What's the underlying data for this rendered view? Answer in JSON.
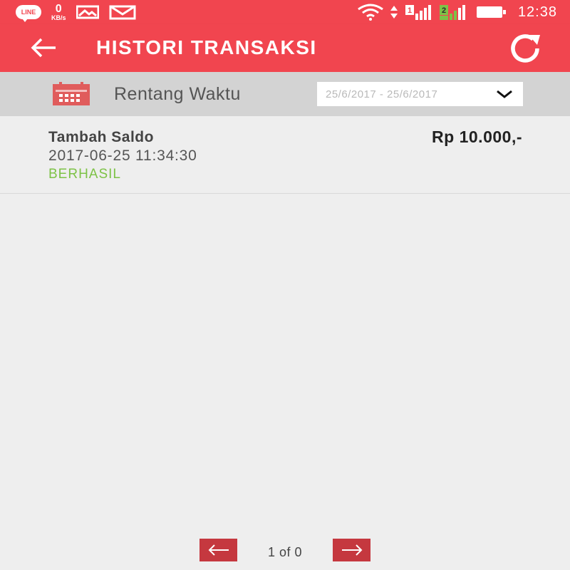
{
  "status_bar": {
    "line_badge": "LINE",
    "speed_value": "0",
    "speed_unit": "KB/s",
    "sim1_label": "1",
    "sim2_label": "2",
    "time": "12:38",
    "icons": [
      "line-icon",
      "image-notification-icon",
      "mail-notification-icon",
      "wifi-icon",
      "data-arrows-icon",
      "signal-sim1-icon",
      "signal-sim2-icon",
      "battery-icon"
    ]
  },
  "app_bar": {
    "title": "HISTORI TRANSAKSI",
    "back_icon": "arrow-left-icon",
    "refresh_icon": "refresh-icon"
  },
  "filter": {
    "label": "Rentang Waktu",
    "icon": "calendar-icon",
    "date_range": "25/6/2017 - 25/6/2017"
  },
  "transactions": [
    {
      "type": "Tambah Saldo",
      "datetime": "2017-06-25 11:34:30",
      "status": "BERHASIL",
      "amount": "Rp 10.000,-"
    }
  ],
  "pagination": {
    "info": "1 of 0",
    "prev_icon": "arrow-left-icon",
    "next_icon": "arrow-right-icon"
  },
  "colors": {
    "primary": "#f1454f",
    "filter_bg": "#d3d3d3",
    "success": "#7dc246",
    "pager_button": "#c5383f",
    "calendar_icon": "#e05c5c"
  }
}
